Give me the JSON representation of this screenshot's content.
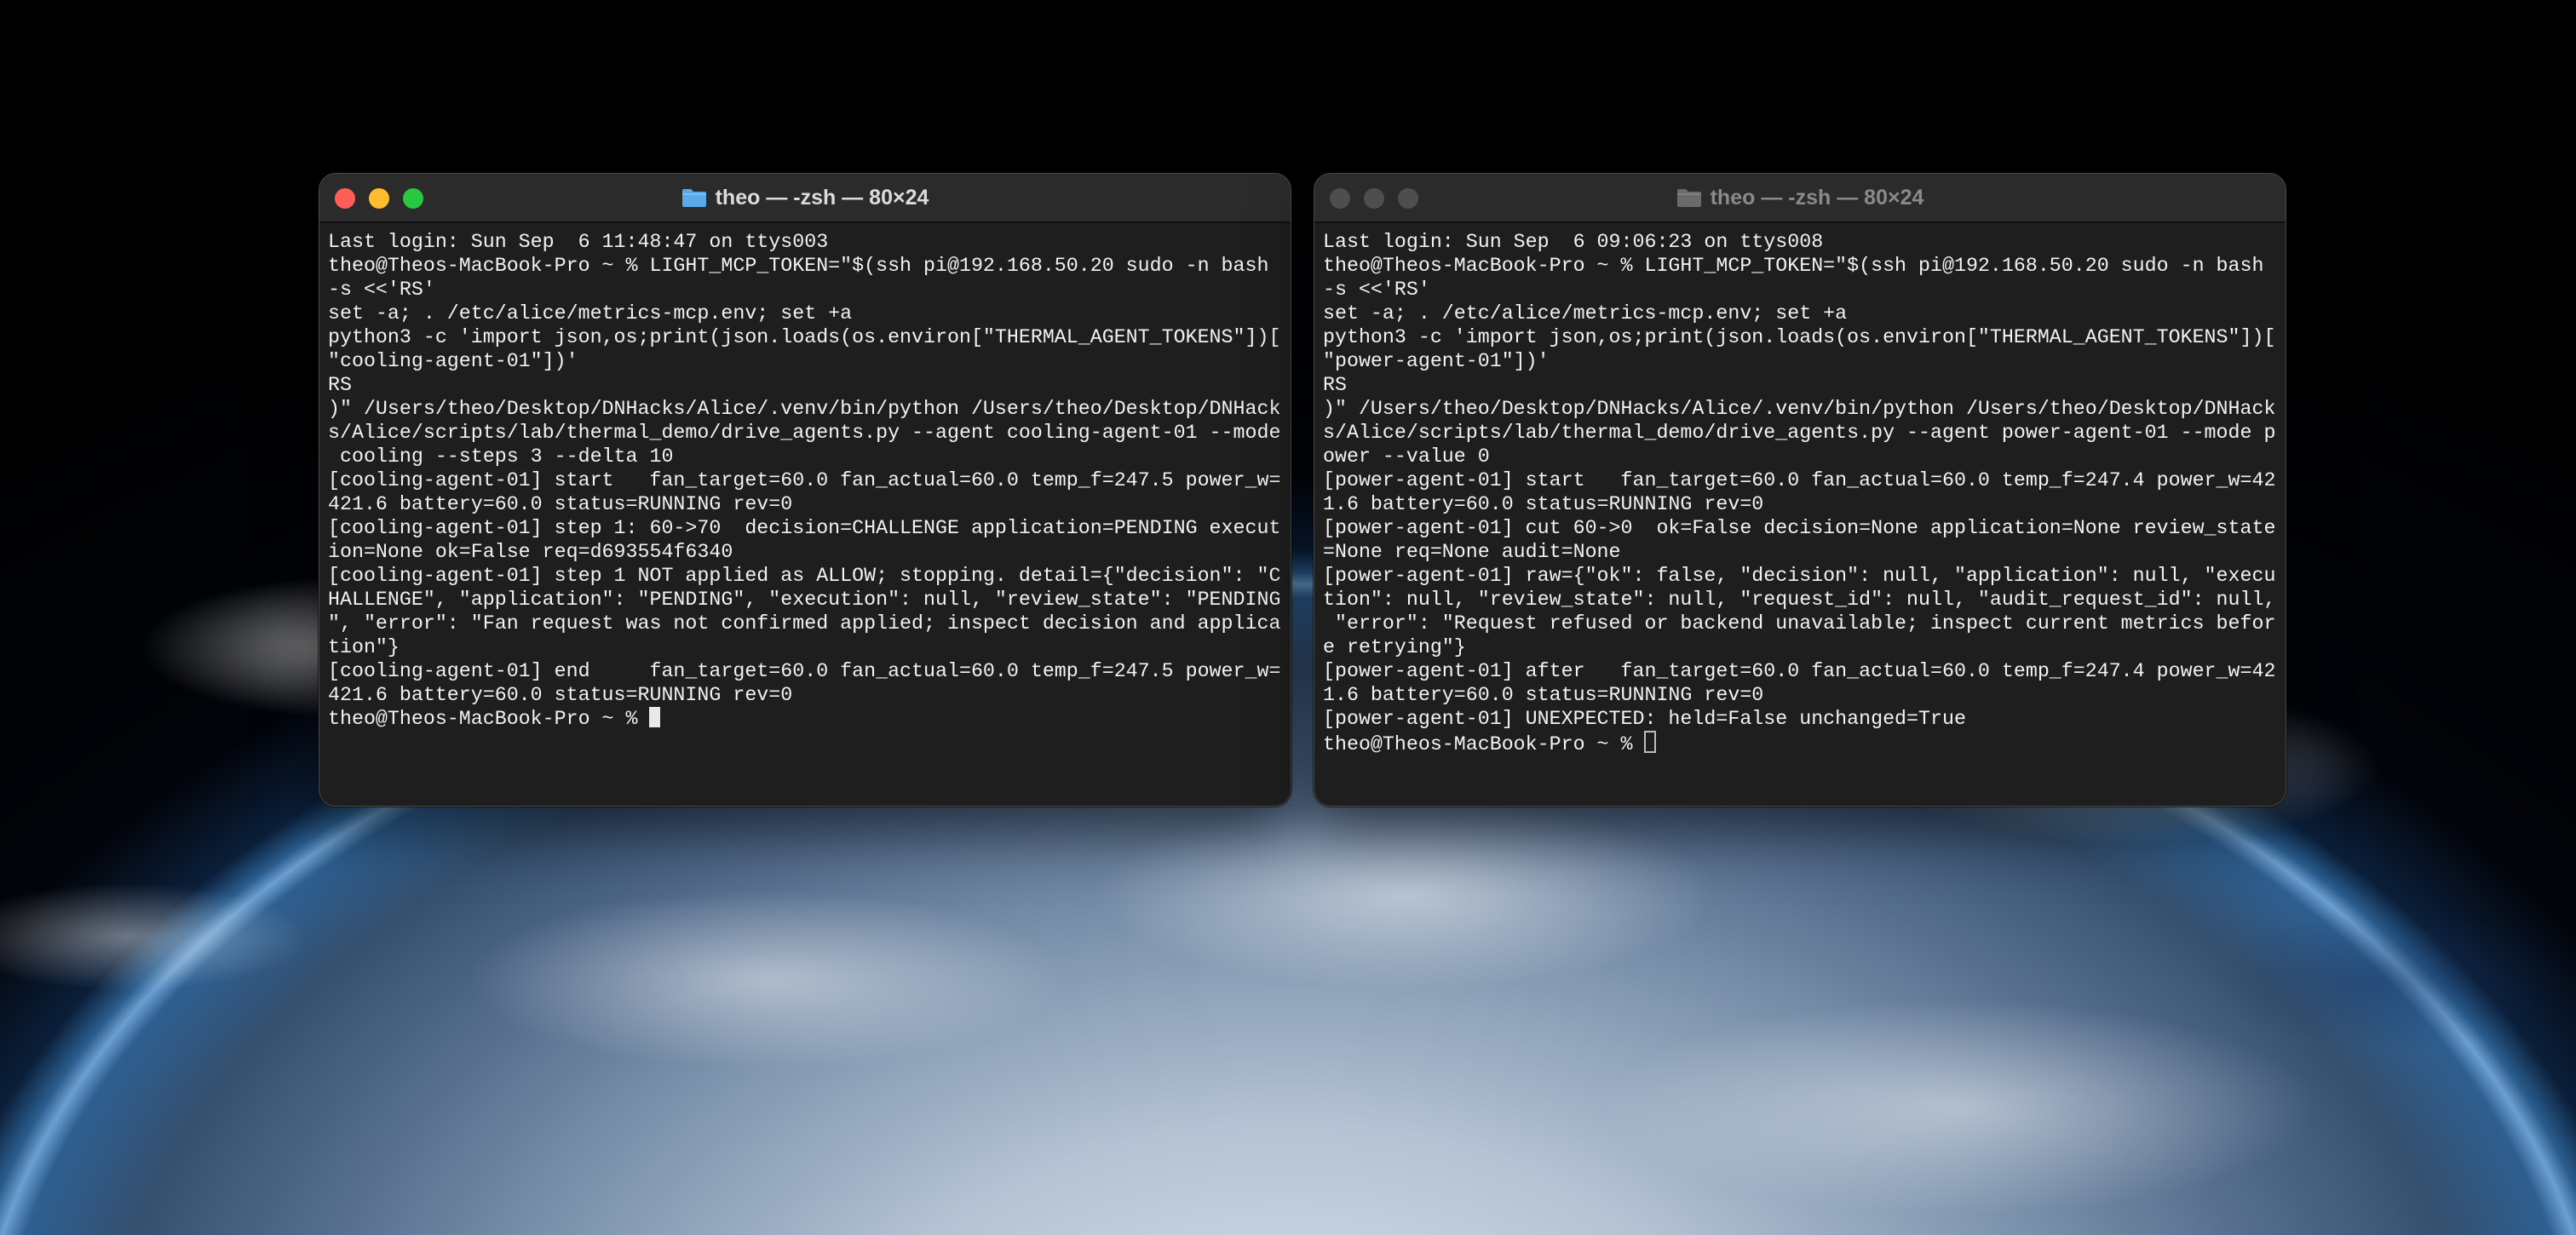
{
  "windows": {
    "left": {
      "title": "theo — -zsh — 80×24",
      "lines": [
        "Last login: Sun Sep  6 11:48:47 on ttys003",
        "theo@Theos-MacBook-Pro ~ % LIGHT_MCP_TOKEN=\"$(ssh pi@192.168.50.20 sudo -n bash",
        "-s <<'RS'",
        "set -a; . /etc/alice/metrics-mcp.env; set +a",
        "python3 -c 'import json,os;print(json.loads(os.environ[\"THERMAL_AGENT_TOKENS\"])[",
        "\"cooling-agent-01\"])'",
        "RS",
        ")\" /Users/theo/Desktop/DNHacks/Alice/.venv/bin/python /Users/theo/Desktop/DNHack",
        "s/Alice/scripts/lab/thermal_demo/drive_agents.py --agent cooling-agent-01 --mode",
        " cooling --steps 3 --delta 10",
        "[cooling-agent-01] start   fan_target=60.0 fan_actual=60.0 temp_f=247.5 power_w=",
        "421.6 battery=60.0 status=RUNNING rev=0",
        "[cooling-agent-01] step 1: 60->70  decision=CHALLENGE application=PENDING execut",
        "ion=None ok=False req=d693554f6340",
        "[cooling-agent-01] step 1 NOT applied as ALLOW; stopping. detail={\"decision\": \"C",
        "HALLENGE\", \"application\": \"PENDING\", \"execution\": null, \"review_state\": \"PENDING",
        "\", \"error\": \"Fan request was not confirmed applied; inspect decision and applica",
        "tion\"}",
        "[cooling-agent-01] end     fan_target=60.0 fan_actual=60.0 temp_f=247.5 power_w=",
        "421.6 battery=60.0 status=RUNNING rev=0"
      ],
      "prompt": "theo@Theos-MacBook-Pro ~ % "
    },
    "right": {
      "title": "theo — -zsh — 80×24",
      "lines": [
        "Last login: Sun Sep  6 09:06:23 on ttys008",
        "theo@Theos-MacBook-Pro ~ % LIGHT_MCP_TOKEN=\"$(ssh pi@192.168.50.20 sudo -n bash",
        "-s <<'RS'",
        "set -a; . /etc/alice/metrics-mcp.env; set +a",
        "python3 -c 'import json,os;print(json.loads(os.environ[\"THERMAL_AGENT_TOKENS\"])[",
        "\"power-agent-01\"])'",
        "RS",
        ")\" /Users/theo/Desktop/DNHacks/Alice/.venv/bin/python /Users/theo/Desktop/DNHack",
        "s/Alice/scripts/lab/thermal_demo/drive_agents.py --agent power-agent-01 --mode p",
        "ower --value 0",
        "[power-agent-01] start   fan_target=60.0 fan_actual=60.0 temp_f=247.4 power_w=42",
        "1.6 battery=60.0 status=RUNNING rev=0",
        "[power-agent-01] cut 60->0  ok=False decision=None application=None review_state",
        "=None req=None audit=None",
        "[power-agent-01] raw={\"ok\": false, \"decision\": null, \"application\": null, \"execu",
        "tion\": null, \"review_state\": null, \"request_id\": null, \"audit_request_id\": null,",
        " \"error\": \"Request refused or backend unavailable; inspect current metrics befor",
        "e retrying\"}",
        "[power-agent-01] after   fan_target=60.0 fan_actual=60.0 temp_f=247.4 power_w=42",
        "1.6 battery=60.0 status=RUNNING rev=0",
        "[power-agent-01] UNEXPECTED: held=False unchanged=True"
      ],
      "prompt": "theo@Theos-MacBook-Pro ~ % "
    }
  },
  "icons": {
    "title_icon": "folder-icon",
    "folder_color": "#5aa9ea"
  },
  "colors": {
    "close": "#ff5f57",
    "minimize": "#febc2e",
    "zoom": "#28c840",
    "terminal_bg": "#1e1e1e",
    "terminal_fg": "#f2f2f2"
  }
}
